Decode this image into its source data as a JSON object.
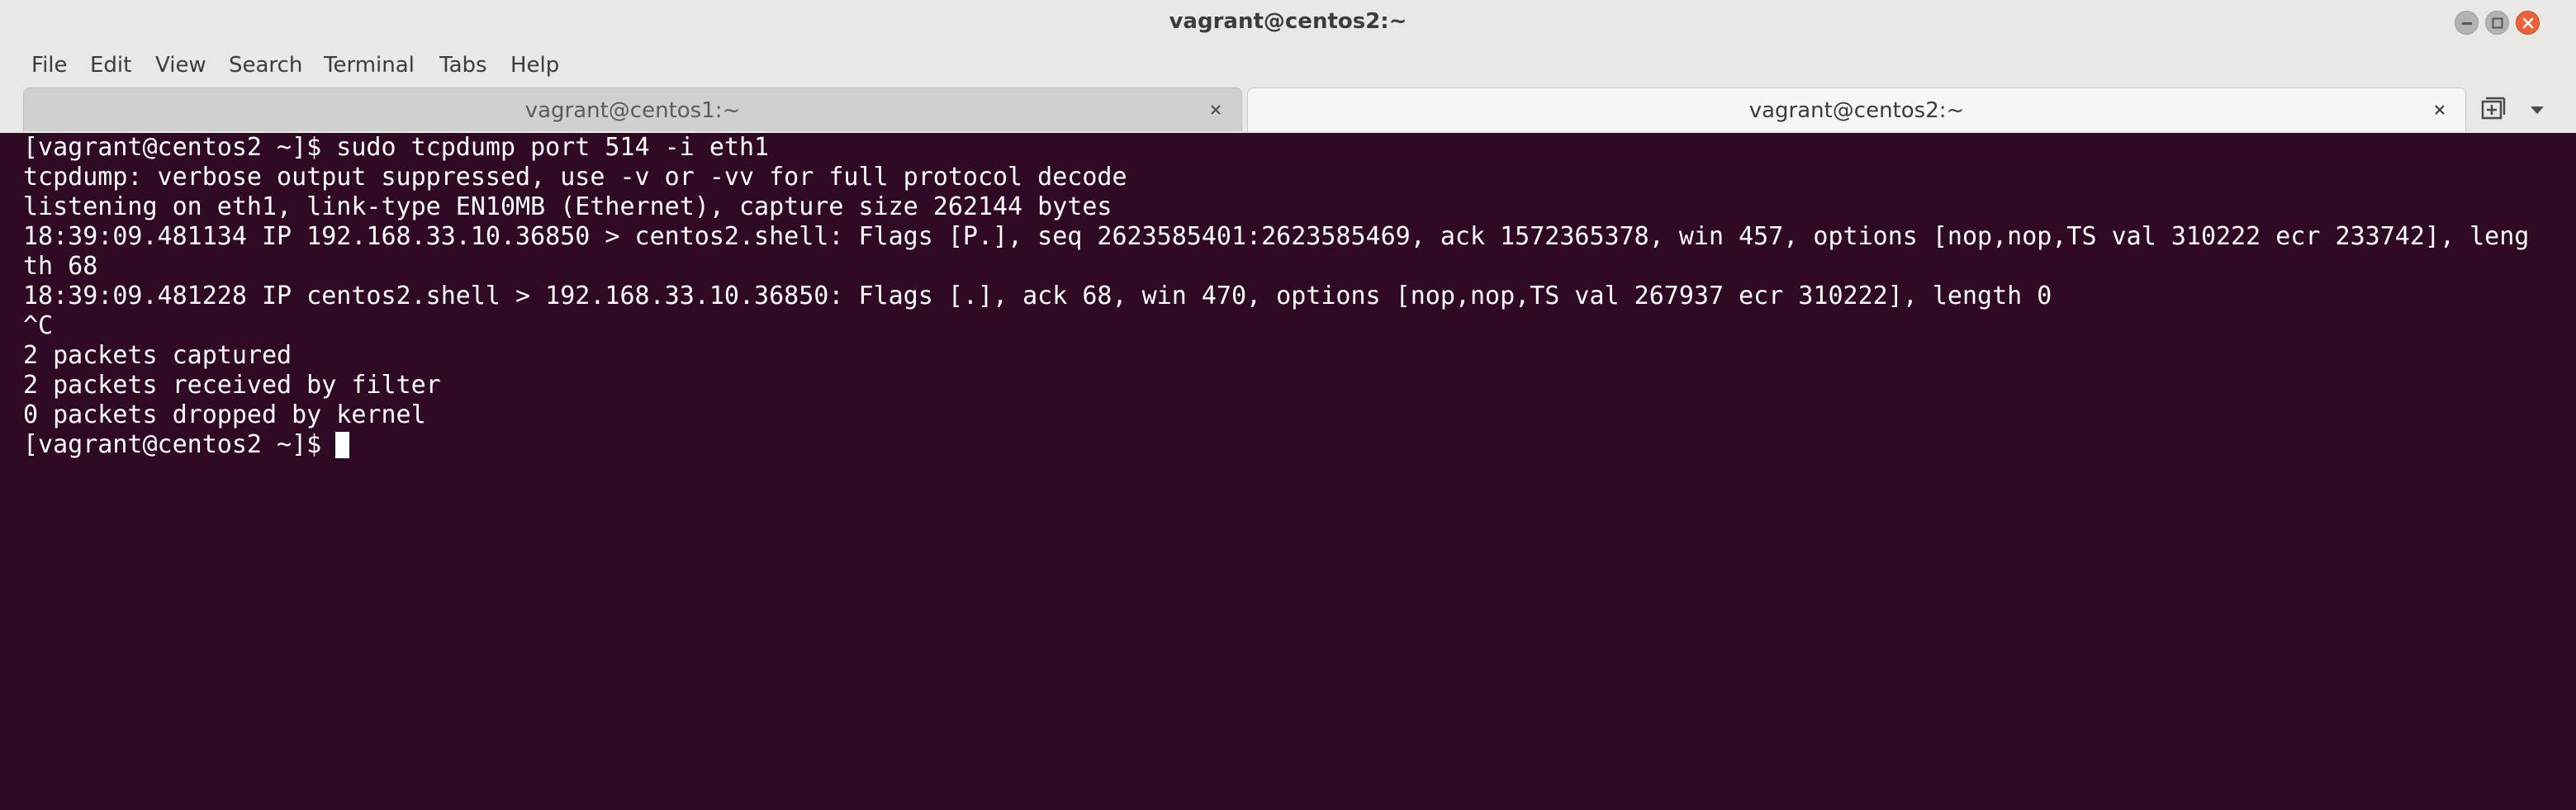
{
  "window": {
    "title": "vagrant@centos2:~"
  },
  "menu": {
    "items": [
      "File",
      "Edit",
      "View",
      "Search",
      "Terminal",
      "Tabs",
      "Help"
    ]
  },
  "tabs": [
    {
      "label": "vagrant@centos1:~",
      "active": false
    },
    {
      "label": "vagrant@centos2:~",
      "active": true
    }
  ],
  "icons": {
    "new_tab": "new-tab-icon",
    "tab_menu": "chevron-down-icon",
    "tab_close": "close-icon",
    "window_min": "minimize-icon",
    "window_max": "maximize-icon",
    "window_close": "close-icon"
  },
  "colors": {
    "terminal_bg": "#300a24",
    "terminal_fg": "#ffffff",
    "chrome_bg": "#e8e8e7",
    "close_button": "#ec6337"
  },
  "terminal": {
    "lines": [
      "[vagrant@centos2 ~]$ sudo tcpdump port 514 -i eth1",
      "tcpdump: verbose output suppressed, use -v or -vv for full protocol decode",
      "listening on eth1, link-type EN10MB (Ethernet), capture size 262144 bytes",
      "18:39:09.481134 IP 192.168.33.10.36850 > centos2.shell: Flags [P.], seq 2623585401:2623585469, ack 1572365378, win 457, options [nop,nop,TS val 310222 ecr 233742], leng",
      "th 68",
      "18:39:09.481228 IP centos2.shell > 192.168.33.10.36850: Flags [.], ack 68, win 470, options [nop,nop,TS val 267937 ecr 310222], length 0",
      "^C",
      "2 packets captured",
      "2 packets received by filter",
      "0 packets dropped by kernel",
      "[vagrant@centos2 ~]$ "
    ]
  }
}
